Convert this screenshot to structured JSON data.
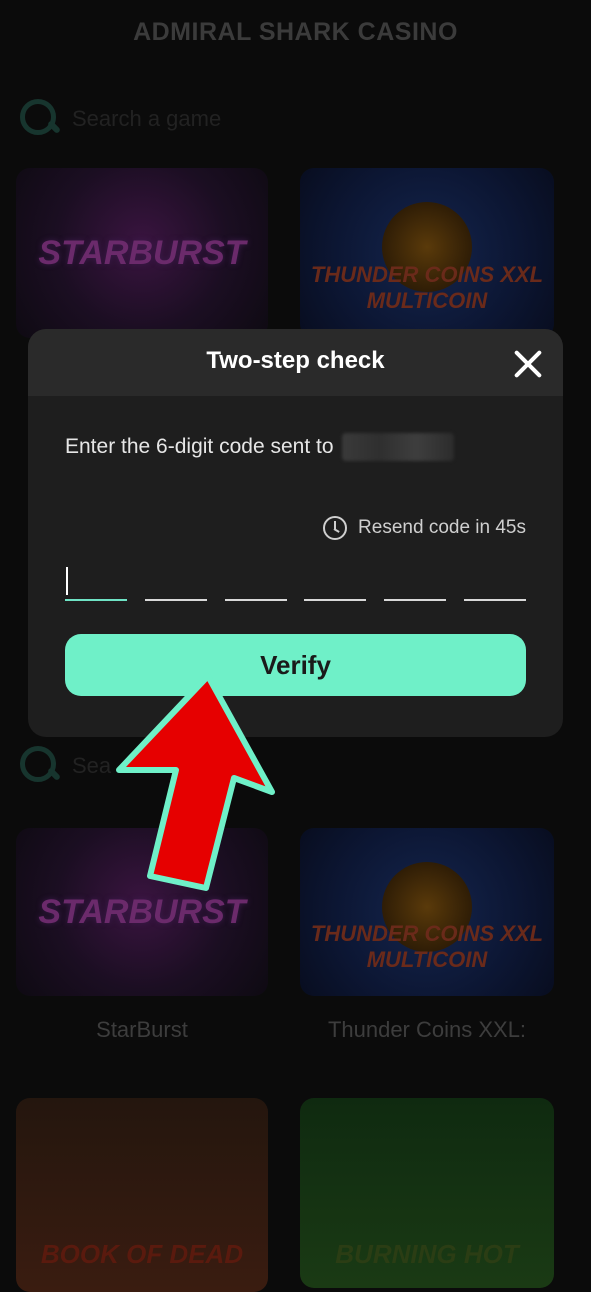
{
  "app": {
    "title": "ADMIRAL SHARK CASINO"
  },
  "search": {
    "placeholder": "Search a game",
    "placeholder_partial": "Sea"
  },
  "games": [
    {
      "tile_text": "STARBURST",
      "name": "StarBurst"
    },
    {
      "tile_text": "THUNDER COINS XXL MULTICOIN",
      "name": "Thunder Coins XXL:"
    },
    {
      "tile_text": "BOOK OF DEAD"
    },
    {
      "tile_text": "BURNING HOT"
    }
  ],
  "modal": {
    "title": "Two-step check",
    "instruction": "Enter the 6-digit code sent to",
    "resend": "Resend code in 45s",
    "verify_label": "Verify",
    "digits": [
      "",
      "",
      "",
      "",
      "",
      ""
    ]
  },
  "colors": {
    "accent": "#6ff0c8",
    "modal_bg": "#1e1e1e",
    "arrow": "#e60000"
  },
  "icons": [
    "search-icon",
    "close-icon",
    "clock-icon",
    "arrow-pointer-icon"
  ]
}
